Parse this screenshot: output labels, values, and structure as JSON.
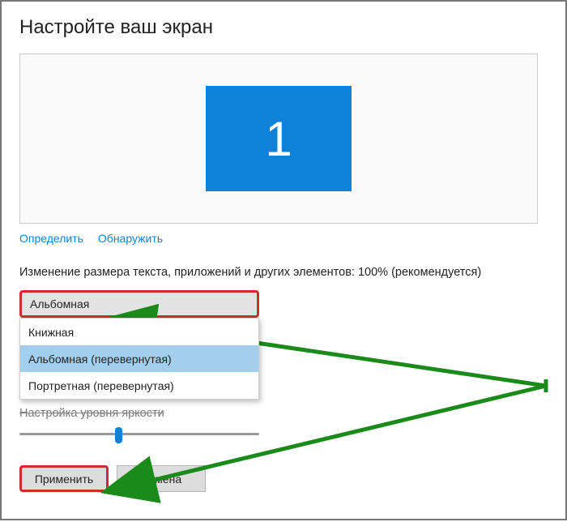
{
  "title": "Настройте ваш экран",
  "monitor": {
    "number": "1"
  },
  "links": {
    "identify": "Определить",
    "detect": "Обнаружить"
  },
  "scale_label": "Изменение размера текста, приложений и других элементов: 100% (рекомендуется)",
  "orientation": {
    "selected": "Альбомная",
    "options": [
      "Книжная",
      "Альбомная (перевернутая)",
      "Портретная (перевернутая)"
    ],
    "highlighted_index": 1
  },
  "brightness_label": "Настройка уровня яркости",
  "buttons": {
    "apply": "Применить",
    "cancel": "Отмена"
  },
  "annotation_color": "#1a8a1a"
}
